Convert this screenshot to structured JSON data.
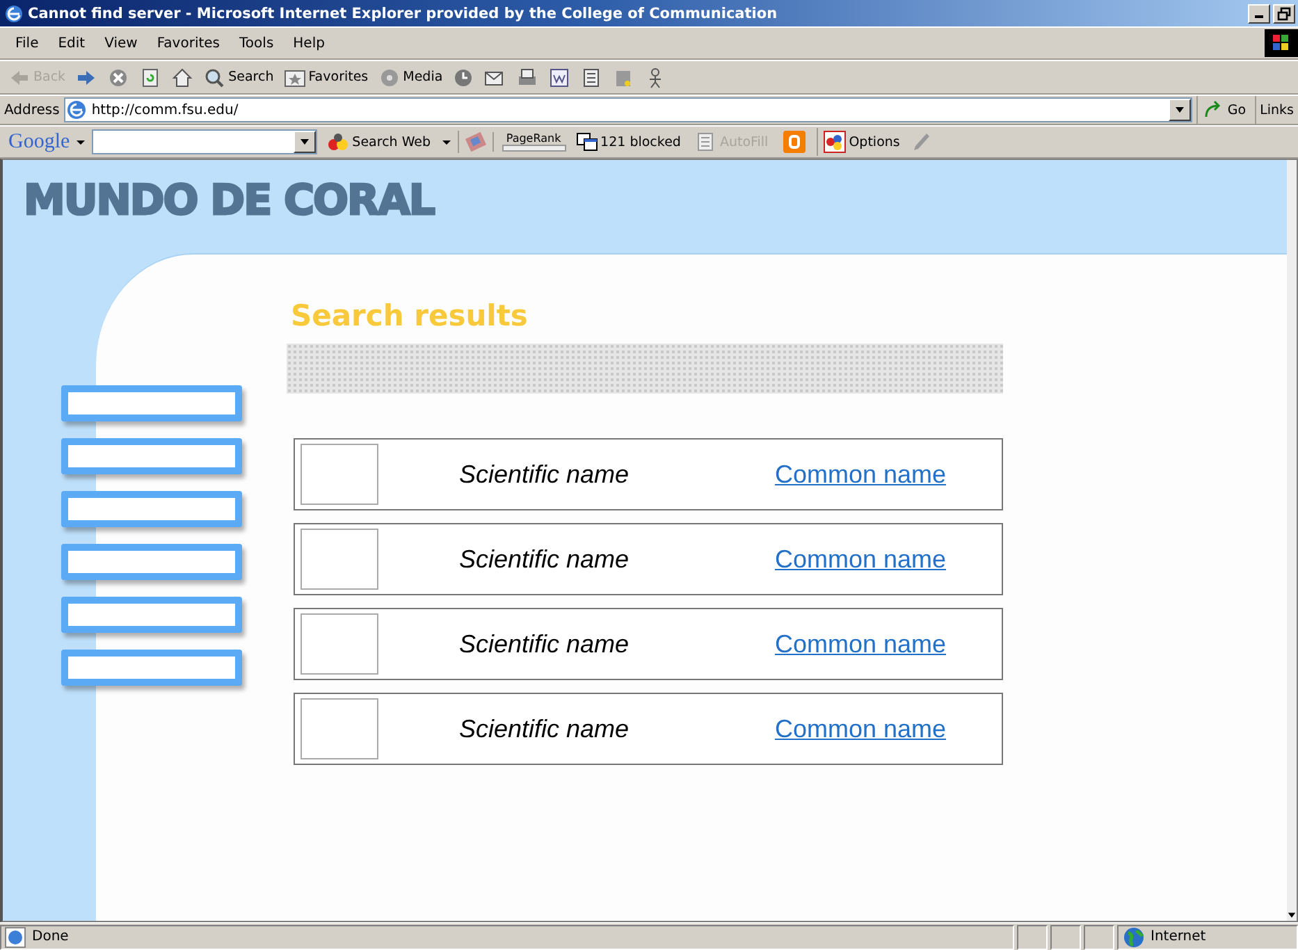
{
  "window": {
    "title": "Cannot find server - Microsoft Internet Explorer provided by the College of Communication"
  },
  "menu": [
    "File",
    "Edit",
    "View",
    "Favorites",
    "Tools",
    "Help"
  ],
  "toolbar": [
    {
      "kind": "back",
      "label": "Back",
      "disabled": true
    },
    {
      "kind": "forward",
      "disabled": false
    },
    {
      "kind": "stop"
    },
    {
      "kind": "refresh"
    },
    {
      "kind": "home"
    },
    {
      "kind": "search",
      "label": "Search"
    },
    {
      "kind": "favorites",
      "label": "Favorites"
    },
    {
      "kind": "media",
      "label": "Media"
    },
    {
      "kind": "history"
    },
    {
      "kind": "mail"
    },
    {
      "kind": "print"
    },
    {
      "kind": "edit"
    },
    {
      "kind": "discuss"
    },
    {
      "kind": "messenger"
    },
    {
      "kind": "person"
    }
  ],
  "address": {
    "label": "Address",
    "value": "http://comm.fsu.edu/",
    "go": "Go",
    "links": "Links"
  },
  "google_bar": {
    "logo": "Google",
    "search_web": "Search Web",
    "pagerank": "PageRank",
    "blocked": "121 blocked",
    "autofill": "AutoFill",
    "options": "Options"
  },
  "page": {
    "logo": "MUNDO DE CORAL",
    "heading": "Search results",
    "results": [
      {
        "scientific": "Scientific name",
        "common": "Common name"
      },
      {
        "scientific": "Scientific name",
        "common": "Common name"
      },
      {
        "scientific": "Scientific name",
        "common": "Common name"
      },
      {
        "scientific": "Scientific name",
        "common": "Common name"
      }
    ]
  },
  "status_bar": {
    "text": "Done",
    "zone": "Internet"
  }
}
